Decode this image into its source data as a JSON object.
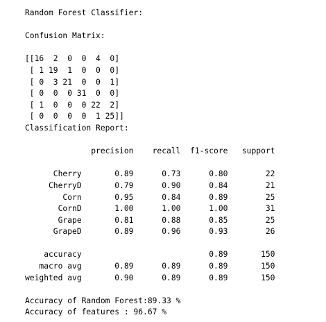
{
  "output": {
    "header": "Random Forest Classifier:",
    "cm_title": "Confusion Matrix:",
    "matrix_lines": [
      "[[16  2  0  0  4  0]",
      " [ 1 19  1  0  0  0]",
      " [ 0  3 21  0  0  1]",
      " [ 0  0  0 31  0  0]",
      " [ 1  0  0  0 22  2]",
      " [ 0  0  0  0  1 25]]"
    ],
    "report_title": "Classification Report:",
    "report_header": "              precision    recall  f1-score   support",
    "report_rows": [
      "      Cherry       0.89      0.73      0.80        22",
      "     CherryD       0.79      0.90      0.84        21",
      "        Corn       0.95      0.84      0.89        25",
      "       CornD       1.00      1.00      1.00        31",
      "       Grape       0.81      0.88      0.85        25",
      "      GrapeD       0.89      0.96      0.93        26"
    ],
    "summary_rows": [
      "    accuracy                           0.89       150",
      "   macro avg       0.89      0.89      0.89       150",
      "weighted avg       0.90      0.89      0.89       150"
    ],
    "accuracy_rf": "Accuracy of Random Forest:89.33 %",
    "accuracy_features": "Accuracy of features : 96.67 %"
  }
}
